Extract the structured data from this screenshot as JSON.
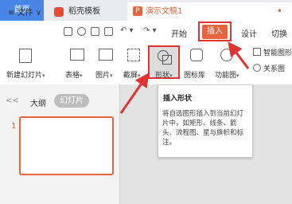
{
  "tabs": {
    "home": "首页",
    "template": "稻壳模板",
    "doc": "演示文稿1",
    "doc_badge": "P",
    "unsaved_dot": "•"
  },
  "menu": {
    "file": "≡ 文件 ∨",
    "start": "开始",
    "insert": "插入",
    "design": "设计",
    "switch": "切换"
  },
  "ribbon": {
    "new_slide": "新建幻灯片",
    "table": "表格",
    "picture": "图片",
    "screenshot": "截屏",
    "shape": "形状",
    "icon_lib": "图标库",
    "function": "功能图",
    "smart": "智能图形",
    "relation": "关系图"
  },
  "left_panel": {
    "collapse": "<<",
    "outline": "大纲",
    "slides": "幻灯片",
    "slide_number": "1"
  },
  "tooltip": {
    "title": "插入形状",
    "body": "将自选图形插入到当前幻灯片中，如矩形、线条、箭头、流程图、星与旗帜和标注。"
  },
  "colors": {
    "accent": "#e8643c",
    "highlight": "#e23333",
    "home_tab": "#4a86e8"
  }
}
